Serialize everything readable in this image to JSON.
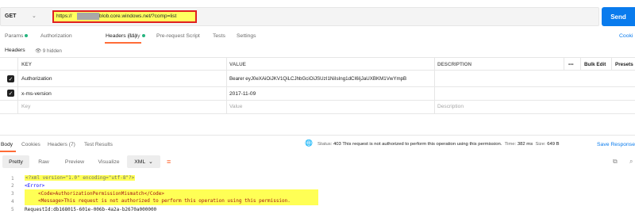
{
  "request": {
    "method": "GET",
    "url_prefix": "https://",
    "url_suffix": "3.blob.core.windows.net/?comp=list",
    "send_label": "Send"
  },
  "req_tabs": [
    {
      "label": "Params"
    },
    {
      "label": "Authorization"
    },
    {
      "label": "Headers (11)"
    },
    {
      "label": "Body"
    },
    {
      "label": "Pre-request Script"
    },
    {
      "label": "Tests"
    },
    {
      "label": "Settings"
    }
  ],
  "cookies_label": "Cooki",
  "headers_label": "Headers",
  "hidden_label": "9 hidden",
  "table": {
    "columns": [
      "KEY",
      "VALUE",
      "DESCRIPTION"
    ],
    "more": "•••",
    "bulk_edit": "Bulk Edit",
    "presets": "Presets",
    "rows": [
      {
        "key": "Authorization",
        "value": "Bearer eyJ0eXAiOiJKV1QiLCJhbGciOiJSUzI1NiIsIng1dCI6IjJaUXBKM1VwYmpB",
        "description": ""
      },
      {
        "key": "x-ms-version",
        "value": "2017-11-09",
        "description": ""
      }
    ],
    "placeholder": {
      "key": "Key",
      "value": "Value",
      "description": "Description"
    }
  },
  "response": {
    "tabs": [
      {
        "label": "Body"
      },
      {
        "label": "Cookies"
      },
      {
        "label": "Headers (7)"
      },
      {
        "label": "Test Results"
      }
    ],
    "status_prefix": "Status:",
    "status_text": "403 This request is not authorized to perform this operation using this permission.",
    "time_prefix": "Time:",
    "time": "382 ms",
    "size_prefix": "Size:",
    "size": "649 B",
    "save_label": "Save Response",
    "views": [
      "Pretty",
      "Raw",
      "Preview",
      "Visualize"
    ],
    "format": "XML",
    "code_lines": [
      {
        "num": "1",
        "text": "<?xml version=\"1.0\" encoding=\"utf-8\"?>"
      },
      {
        "num": "2",
        "text": "<Error>"
      },
      {
        "num": "3",
        "text": "<Code>AuthorizationPermissionMismatch</Code>"
      },
      {
        "num": "4",
        "text": "<Message>This request is not authorized to perform this operation using this permission."
      },
      {
        "num": "5",
        "text": "RequestId:db168015-601e-006b-4a2a-b2670a000000"
      }
    ]
  },
  "colors": {
    "accent": "#ff6c37",
    "send": "#097bed",
    "url_highlight": "#ffff60",
    "url_border": "#e02020",
    "code_highlight": "#ffff55",
    "status_ok_dot": "#26b47f"
  }
}
